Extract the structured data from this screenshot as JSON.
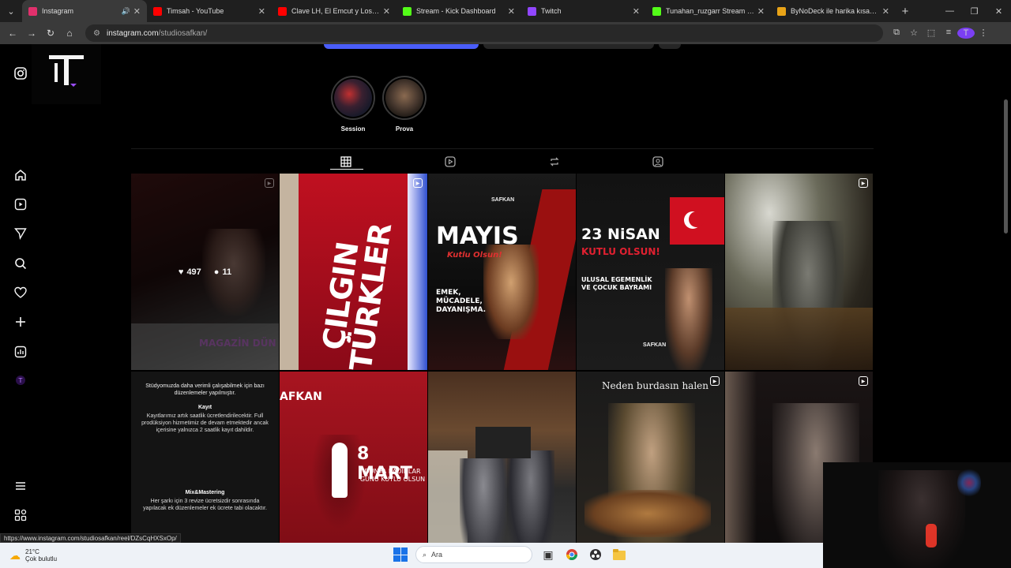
{
  "browser": {
    "tabs": [
      {
        "title": "Instagram",
        "favicon_color": "#e1306c",
        "active": true,
        "audio": true
      },
      {
        "title": "Timsah - YouTube",
        "favicon_color": "#ff0000",
        "active": false
      },
      {
        "title": "Clave LH, El Emcut y Los Primos",
        "favicon_color": "#ff0000",
        "active": false
      },
      {
        "title": "Stream - Kick Dashboard",
        "favicon_color": "#53fc18",
        "active": false
      },
      {
        "title": "Twitch",
        "favicon_color": "#9146ff",
        "active": false
      },
      {
        "title": "Tunahan_ruzgarr Stream - Watch",
        "favicon_color": "#53fc18",
        "active": false
      },
      {
        "title": "ByNoDeck ile harika kısayollar",
        "favicon_color": "#e8a317",
        "active": false
      }
    ],
    "url_host": "instagram.com",
    "url_path": "/studiosafkan/",
    "profile_initial": "T",
    "status_url": "https://www.instagram.com/studiosafkan/reel/DZsCqHXSxOp/"
  },
  "highlights": [
    {
      "label": "Session"
    },
    {
      "label": "Prova"
    }
  ],
  "hover_stats": {
    "likes": "497",
    "comments": "11"
  },
  "posts": {
    "p1_caption": "MAGAZİN DÜN",
    "p2_title": "ÇILGIN TÜRKLER",
    "p3_title": "MAYIS",
    "p3_script": "Kutlu Olsun!",
    "p3_sub": "EMEK, MÜCADELE, DAYANIŞMA.",
    "p3_brand": "SAFKAN",
    "p4_title": "23 NiSAN",
    "p4_script": "KUTLU OLSUN!",
    "p4_sub": "ULUSAL EGEMENLİK VE ÇOCUK BAYRAMI",
    "p4_brand": "SAFKAN",
    "p6_heading": "Stüdyomuzda daha verimli çalışabilmek için bazı düzenlemeler yapılmıştır.",
    "p6_kayit": "Kayıt",
    "p6_mix": "Mix&Mastering",
    "p6_body1": "Kayıtlarımız artık saatlik ücretlendirilecektir. Full prodüksiyon hizmetimiz de devam etmektedir ancak içerisine yalnızca 2 saatlik kayıt dahildir.",
    "p6_body2": "Her şarkı için 3 revize ücretsizdir sonrasında yapılacak ek düzenlemeler ek ücrete tabi olacaktır.",
    "p7_brand": "AFKAN",
    "p7_title": "8 MART",
    "p7_sub": "DÜNYA KADINLAR GÜNÜ KUTLU OLSUN",
    "p9_caption": "Neden burdasın halen"
  },
  "taskbar": {
    "temp": "21°C",
    "weather": "Çok bulutlu",
    "search_placeholder": "Ara"
  }
}
